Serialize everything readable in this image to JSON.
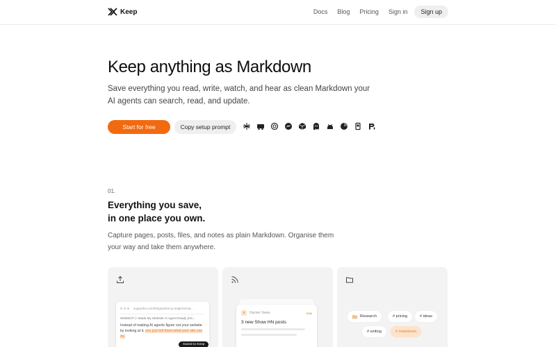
{
  "brand": {
    "name": "Keep"
  },
  "nav": {
    "links": [
      "Docs",
      "Blog",
      "Pricing",
      "Sign in"
    ],
    "cta": "Sign up"
  },
  "hero": {
    "title": "Keep anything as Markdown",
    "subtitle": "Save everything you read, write, watch, and hear as clean Markdown your AI agents can search, read, and update.",
    "primary_button": "Start for free",
    "secondary_button": "Copy setup prompt",
    "integrations": [
      "asterisk-icon",
      "raycast-icon",
      "openai-icon",
      "messenger-icon",
      "box-icon",
      "ghost-icon",
      "android-icon",
      "pie-icon",
      "bookmark-icon",
      "pi-icon"
    ]
  },
  "section": {
    "number": "01.",
    "title_line1": "Everything you save,",
    "title_line2": "in one place you own.",
    "description": "Capture pages, posts, files, and notes as plain Markdown. Organise them your way and take them anywhere."
  },
  "cards": {
    "capture": {
      "icon": "upload-icon",
      "url": "sugantha.com/blog/webmcp-implementa…",
      "page_title": "WebMCP | I Made My Website AI Agent Ready (Ho…",
      "body_plain": "Instead of making AI agents figure out your website by looking at it, ",
      "body_highlight": "you just tell them what your site can do.",
      "saved_label": "Saved to Keep"
    },
    "feeds": {
      "icon": "rss-icon",
      "badge": "Y",
      "source": "Hacker News",
      "status": "now",
      "title": "3 new Show HN posts"
    },
    "organise": {
      "icon": "folder-icon",
      "tags": [
        "Research",
        "# pricing",
        "# ideas",
        "# writing",
        "# markdown"
      ]
    }
  },
  "colors": {
    "accent": "#f26a0f",
    "highlight_bg": "#fde3cc",
    "card_bg": "#f3f3f3"
  }
}
